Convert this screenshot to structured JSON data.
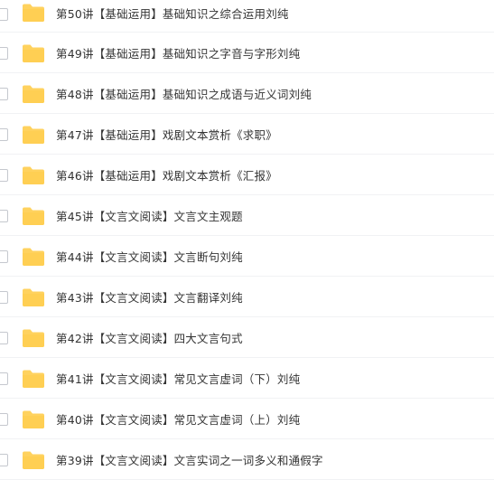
{
  "file_list": {
    "icon": "folder-icon",
    "folder_color": "#FFD25E",
    "items": [
      {
        "name": "第50讲【基础运用】基础知识之综合运用刘纯"
      },
      {
        "name": "第49讲【基础运用】基础知识之字音与字形刘纯"
      },
      {
        "name": "第48讲【基础运用】基础知识之成语与近义词刘纯"
      },
      {
        "name": "第47讲【基础运用】戏剧文本赏析《求职》"
      },
      {
        "name": "第46讲【基础运用】戏剧文本赏析《汇报》"
      },
      {
        "name": "第45讲【文言文阅读】文言文主观题"
      },
      {
        "name": "第44讲【文言文阅读】文言断句刘纯"
      },
      {
        "name": "第43讲【文言文阅读】文言翻译刘纯"
      },
      {
        "name": "第42讲【文言文阅读】四大文言句式"
      },
      {
        "name": "第41讲【文言文阅读】常见文言虚词（下）刘纯"
      },
      {
        "name": "第40讲【文言文阅读】常见文言虚词（上）刘纯"
      },
      {
        "name": "第39讲【文言文阅读】文言实词之一词多义和通假字"
      }
    ]
  }
}
